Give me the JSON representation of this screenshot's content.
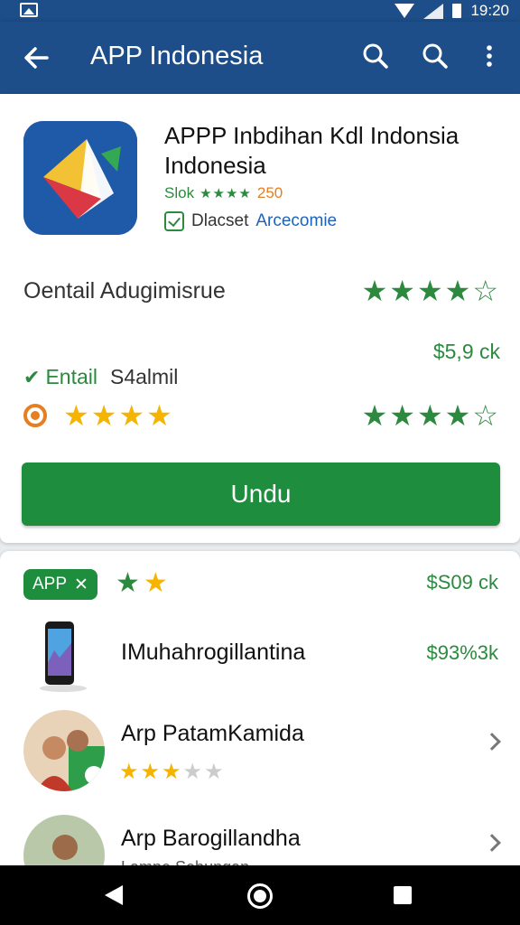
{
  "status_bar": {
    "time": "19:20"
  },
  "app_bar": {
    "title": "APP Indonesia"
  },
  "app": {
    "name": "APPP Inbdihan Kdl Indonsia Indonesia",
    "meta_label": "Slok",
    "meta_stars": "★★★★",
    "meta_count": "250",
    "badge_text": "Dlacset",
    "badge_link": "Arcecomie"
  },
  "details": {
    "row1_label": "Oentail Adugimisrue",
    "row2_label": "Entail",
    "row2_value": "S4almil",
    "row2_price": "$5,9 ck"
  },
  "install_button": {
    "label": "Undu"
  },
  "section": {
    "chip_label": "APP",
    "chip_price": "$S09 ck",
    "items": [
      {
        "title": "IMuhahrogillantina",
        "price": "$93%3k"
      },
      {
        "title": "Arp PatamKamida"
      },
      {
        "title": "Arp Barogillandha",
        "subtitle": "Lampe Sebungan"
      }
    ]
  },
  "colors": {
    "brand": "#1d4e89",
    "accent": "#1e8e3e",
    "star": "#f4b400"
  }
}
